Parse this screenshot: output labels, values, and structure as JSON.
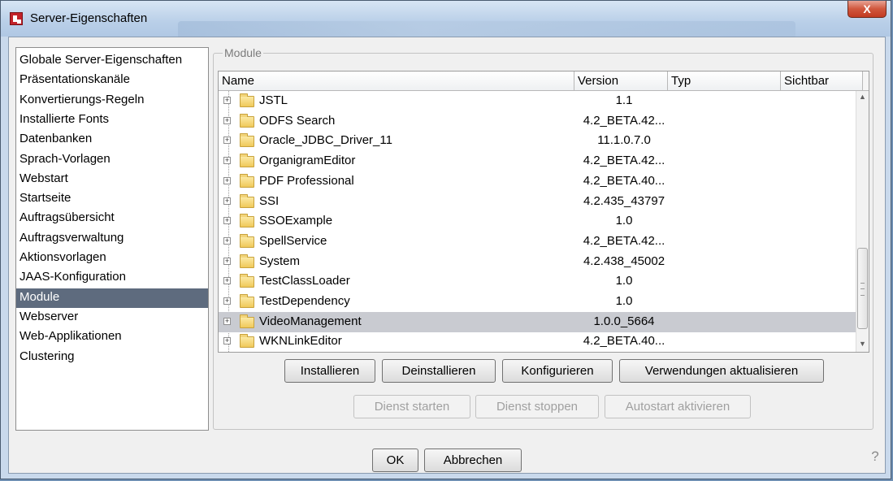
{
  "window": {
    "title": "Server-Eigenschaften",
    "close_symbol": "X"
  },
  "sidebar": {
    "items": [
      {
        "label": "Globale Server-Eigenschaften"
      },
      {
        "label": "Präsentationskanäle"
      },
      {
        "label": "Konvertierungs-Regeln"
      },
      {
        "label": "Installierte Fonts"
      },
      {
        "label": "Datenbanken"
      },
      {
        "label": "Sprach-Vorlagen"
      },
      {
        "label": "Webstart"
      },
      {
        "label": "Startseite"
      },
      {
        "label": "Auftragsübersicht"
      },
      {
        "label": "Auftragsverwaltung"
      },
      {
        "label": "Aktionsvorlagen"
      },
      {
        "label": "JAAS-Konfiguration"
      },
      {
        "label": "Module"
      },
      {
        "label": "Webserver"
      },
      {
        "label": "Web-Applikationen"
      },
      {
        "label": "Clustering"
      }
    ],
    "selected_index": 12
  },
  "modules": {
    "group_title": "Module",
    "columns": [
      "Name",
      "Version",
      "Typ",
      "Sichtbar"
    ],
    "rows": [
      {
        "name": "JSTL",
        "version": "1.1"
      },
      {
        "name": "ODFS Search",
        "version": "4.2_BETA.42..."
      },
      {
        "name": "Oracle_JDBC_Driver_11",
        "version": "11.1.0.7.0"
      },
      {
        "name": "OrganigramEditor",
        "version": "4.2_BETA.42..."
      },
      {
        "name": "PDF Professional",
        "version": "4.2_BETA.40..."
      },
      {
        "name": "SSI",
        "version": "4.2.435_43797"
      },
      {
        "name": "SSOExample",
        "version": "1.0"
      },
      {
        "name": "SpellService",
        "version": "4.2_BETA.42..."
      },
      {
        "name": "System",
        "version": "4.2.438_45002"
      },
      {
        "name": "TestClassLoader",
        "version": "1.0"
      },
      {
        "name": "TestDependency",
        "version": "1.0"
      },
      {
        "name": "VideoManagement",
        "version": "1.0.0_5664"
      },
      {
        "name": "WKNLinkEditor",
        "version": "4.2_BETA.40..."
      }
    ],
    "selected_row": 11,
    "expander_symbol": "+",
    "scroll_up_symbol": "▲",
    "scroll_down_symbol": "▼"
  },
  "buttons": {
    "install": "Installieren",
    "uninstall": "Deinstallieren",
    "configure": "Konfigurieren",
    "update_usages": "Verwendungen aktualisieren",
    "start_service": "Dienst starten",
    "stop_service": "Dienst stoppen",
    "autostart": "Autostart aktivieren",
    "ok": "OK",
    "cancel": "Abbrechen",
    "help": "?"
  },
  "colors": {
    "selection_sidebar": "#5e6b7e",
    "selection_row": "#c9cbd1",
    "close_button": "#c23b22"
  }
}
